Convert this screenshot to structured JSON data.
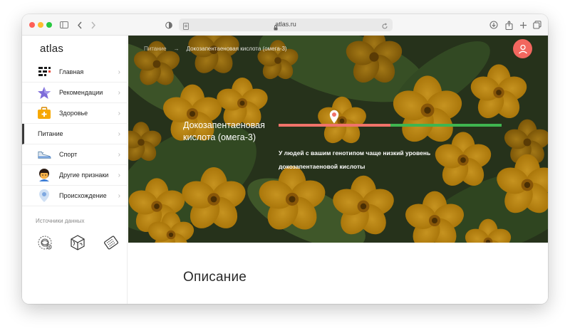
{
  "browser": {
    "url": "atlas.ru"
  },
  "sidebar": {
    "brand": "atlas",
    "items": [
      {
        "label": "Главная",
        "icon": "grid-icon"
      },
      {
        "label": "Рекомендации",
        "icon": "star-icon"
      },
      {
        "label": "Здоровье",
        "icon": "first-aid-kit-icon"
      },
      {
        "label": "Питание",
        "icon": "",
        "active": true
      },
      {
        "label": "Спорт",
        "icon": "sneaker-icon"
      },
      {
        "label": "Другие признаки",
        "icon": "person-avatar-icon"
      },
      {
        "label": "Происхождение",
        "icon": "location-pin-icon"
      }
    ],
    "sources_title": "Источники данных",
    "sources": [
      {
        "icon": "dna-sphere-icon"
      },
      {
        "icon": "dna-cube-icon"
      },
      {
        "icon": "lab-chip-icon"
      }
    ]
  },
  "hero": {
    "breadcrumb": {
      "parent": "Питание",
      "separator": "→",
      "current": "Докозапентаеновая кислота (омега-3)"
    },
    "trait_title": "Докозапентаеновая кислота (омега-3)",
    "scale_level": 0.25,
    "scale_split": 0.5,
    "result_text": "У людей с вашим генотипом чаще низкий уровень докозапентаеновой кислоты"
  },
  "content": {
    "section_title": "Описание"
  },
  "colors": {
    "accent": "#f2675f",
    "scale_low": "#f0736a",
    "scale_high": "#3fb54f"
  }
}
